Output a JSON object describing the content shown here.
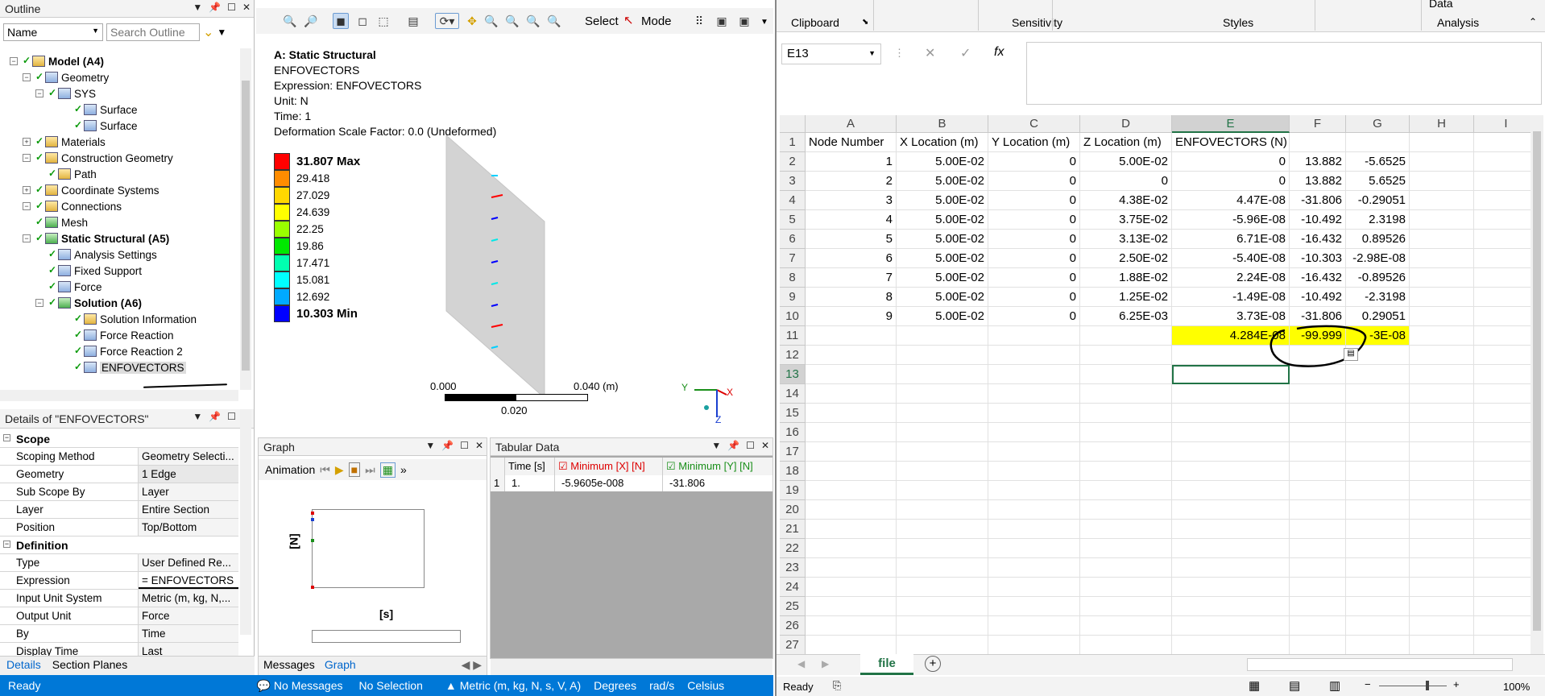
{
  "outline": {
    "title": "Outline",
    "name_filter": "Name",
    "search_placeholder": "Search Outline",
    "tree": [
      {
        "label": "Model (A4)",
        "bold": true
      },
      {
        "label": "Geometry"
      },
      {
        "label": "SYS"
      },
      {
        "label": "Surface"
      },
      {
        "label": "Surface"
      },
      {
        "label": "Materials"
      },
      {
        "label": "Construction Geometry"
      },
      {
        "label": "Path"
      },
      {
        "label": "Coordinate Systems"
      },
      {
        "label": "Connections"
      },
      {
        "label": "Mesh"
      },
      {
        "label": "Static Structural (A5)",
        "bold": true
      },
      {
        "label": "Analysis Settings"
      },
      {
        "label": "Fixed Support"
      },
      {
        "label": "Force"
      },
      {
        "label": "Solution (A6)",
        "bold": true
      },
      {
        "label": "Solution Information"
      },
      {
        "label": "Force Reaction"
      },
      {
        "label": "Force Reaction 2"
      },
      {
        "label": "ENFOVECTORS"
      }
    ]
  },
  "details": {
    "title": "Details of \"ENFOVECTORS\"",
    "sections": [
      {
        "name": "Scope",
        "rows": [
          {
            "k": "Scoping Method",
            "v": "Geometry Selecti..."
          },
          {
            "k": "Geometry",
            "v": "1 Edge"
          },
          {
            "k": "Sub Scope By",
            "v": "Layer"
          },
          {
            "k": "Layer",
            "v": "Entire Section"
          },
          {
            "k": "Position",
            "v": "Top/Bottom"
          }
        ]
      },
      {
        "name": "Definition",
        "rows": [
          {
            "k": "Type",
            "v": "User Defined Re..."
          },
          {
            "k": "Expression",
            "v": "= ENFOVECTORS"
          },
          {
            "k": "Input Unit System",
            "v": "Metric (m, kg, N,..."
          },
          {
            "k": "Output Unit",
            "v": "Force"
          },
          {
            "k": "By",
            "v": "Time"
          },
          {
            "k": "Display Time",
            "v": "Last"
          }
        ]
      }
    ],
    "tabs": [
      "Details",
      "Section Planes"
    ]
  },
  "viewer": {
    "toolbar": {
      "select_label": "Select",
      "mode_label": "Mode"
    },
    "result_title": "A: Static Structural",
    "result_name": "ENFOVECTORS",
    "expression": "Expression: ENFOVECTORS",
    "unit": "Unit: N",
    "time": "Time: 1",
    "scale": "Deformation Scale Factor: 0.0 (Undeformed)",
    "legend": [
      {
        "value": "31.807 Max",
        "color": "#ff0000",
        "bold": true
      },
      {
        "value": "29.418",
        "color": "#ff8c00"
      },
      {
        "value": "27.029",
        "color": "#ffd700"
      },
      {
        "value": "24.639",
        "color": "#ffff00"
      },
      {
        "value": "22.25",
        "color": "#9aff00"
      },
      {
        "value": "19.86",
        "color": "#00e800"
      },
      {
        "value": "17.471",
        "color": "#00ffb0"
      },
      {
        "value": "15.081",
        "color": "#00ffff"
      },
      {
        "value": "12.692",
        "color": "#00aaff"
      },
      {
        "value": "10.303 Min",
        "color": "#0000ff",
        "bold": true
      }
    ],
    "scale_bar": {
      "left": "0.000",
      "right": "0.040 (m)",
      "mid": "0.020"
    },
    "triad": {
      "x": "X",
      "y": "Y",
      "z": "Z"
    }
  },
  "graph": {
    "title": "Graph",
    "animation_label": "Animation",
    "y_label": "[N]",
    "x_label": "[s]",
    "tabs": [
      "Messages",
      "Graph"
    ]
  },
  "tabular": {
    "title": "Tabular Data",
    "headers": [
      "Time [s]",
      "Minimum [X] [N]",
      "Minimum [Y] [N]"
    ],
    "rows": [
      {
        "idx": "1",
        "time": "1.",
        "minx": "-5.9605e-008",
        "miny": "-31.806"
      }
    ]
  },
  "statusbar": {
    "ready": "Ready",
    "messages": "No Messages",
    "selection": "No Selection",
    "units": "Metric (m, kg, N, s, V, A)",
    "degrees": "Degrees",
    "rads": "rad/s",
    "celsius": "Celsius"
  },
  "excel": {
    "ribbon": {
      "clipboard": "Clipboard",
      "sensitivity": "Sensitivity",
      "styles": "Styles",
      "analysis": "Analysis",
      "data": "Data"
    },
    "name_box": "E13",
    "formula_icons": {
      "cancel": "✕",
      "enter": "✓",
      "fx": "fx"
    },
    "columns": [
      "A",
      "B",
      "C",
      "D",
      "E",
      "F",
      "G",
      "H",
      "I"
    ],
    "rows": [
      [
        "Node Number",
        "X Location (m)",
        "Y Location (m)",
        "Z Location (m)",
        "ENFOVECTORS (N)",
        "",
        "",
        "",
        ""
      ],
      [
        "1",
        "5.00E-02",
        "0",
        "5.00E-02",
        "0",
        "13.882",
        "-5.6525",
        "",
        ""
      ],
      [
        "2",
        "5.00E-02",
        "0",
        "0",
        "0",
        "13.882",
        "5.6525",
        "",
        ""
      ],
      [
        "3",
        "5.00E-02",
        "0",
        "4.38E-02",
        "4.47E-08",
        "-31.806",
        "-0.29051",
        "",
        ""
      ],
      [
        "4",
        "5.00E-02",
        "0",
        "3.75E-02",
        "-5.96E-08",
        "-10.492",
        "2.3198",
        "",
        ""
      ],
      [
        "5",
        "5.00E-02",
        "0",
        "3.13E-02",
        "6.71E-08",
        "-16.432",
        "0.89526",
        "",
        ""
      ],
      [
        "6",
        "5.00E-02",
        "0",
        "2.50E-02",
        "-5.40E-08",
        "-10.303",
        "-2.98E-08",
        "",
        ""
      ],
      [
        "7",
        "5.00E-02",
        "0",
        "1.88E-02",
        "2.24E-08",
        "-16.432",
        "-0.89526",
        "",
        ""
      ],
      [
        "8",
        "5.00E-02",
        "0",
        "1.25E-02",
        "-1.49E-08",
        "-10.492",
        "-2.3198",
        "",
        ""
      ],
      [
        "9",
        "5.00E-02",
        "0",
        "6.25E-03",
        "3.73E-08",
        "-31.806",
        "0.29051",
        "",
        ""
      ],
      [
        "",
        "",
        "",
        "",
        "4.284E-08",
        "-99.999",
        "-3E-08",
        "",
        ""
      ]
    ],
    "row_numbers": [
      "1",
      "2",
      "3",
      "4",
      "5",
      "6",
      "7",
      "8",
      "9",
      "10",
      "11",
      "12",
      "13",
      "14",
      "15",
      "16",
      "17",
      "18",
      "19",
      "20",
      "21",
      "22",
      "23",
      "24",
      "25",
      "26",
      "27"
    ],
    "sheet_tab": "file",
    "status": {
      "ready": "Ready",
      "zoom": "100%"
    }
  }
}
